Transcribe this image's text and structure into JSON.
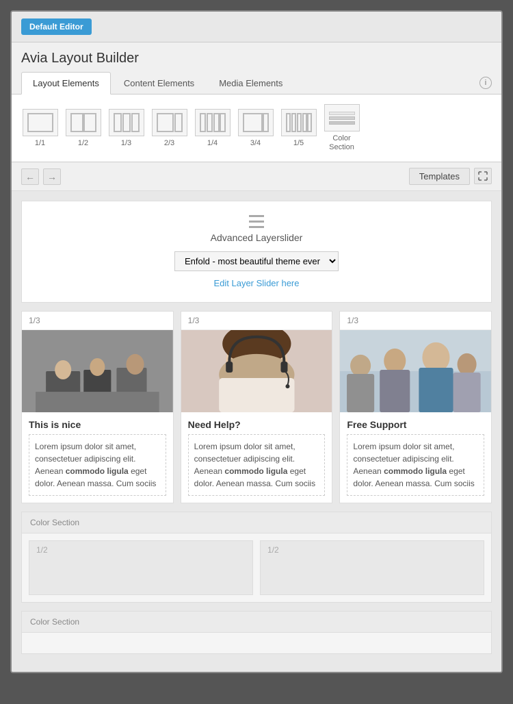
{
  "topBar": {
    "defaultEditorLabel": "Default Editor"
  },
  "pageTitle": "Avia Layout Builder",
  "tabs": [
    {
      "id": "layout",
      "label": "Layout Elements",
      "active": true
    },
    {
      "id": "content",
      "label": "Content Elements",
      "active": false
    },
    {
      "id": "media",
      "label": "Media Elements",
      "active": false
    }
  ],
  "elements": [
    {
      "label": "1/1",
      "type": "single"
    },
    {
      "label": "1/2",
      "type": "half"
    },
    {
      "label": "1/3",
      "type": "third"
    },
    {
      "label": "2/3",
      "type": "two-third"
    },
    {
      "label": "1/4",
      "type": "quarter"
    },
    {
      "label": "3/4",
      "type": "three-quarter"
    },
    {
      "label": "1/5",
      "type": "fifth"
    },
    {
      "label": "Color\nSection",
      "type": "color"
    }
  ],
  "toolbar": {
    "undoLabel": "←",
    "redoLabel": "→",
    "templatesLabel": "Templates",
    "fullscreenLabel": "⛶"
  },
  "layerSlider": {
    "title": "Advanced Layerslider",
    "selectValue": "Enfold - most beautiful theme ever",
    "editLink": "Edit Layer Slider here"
  },
  "columns": [
    {
      "header": "1/3",
      "imageAlt": "business meeting",
      "contentTitle": "This is nice",
      "bodyText": "Lorem ipsum dolor sit amet, consectetuer adipiscing elit. Aenean ",
      "boldText": "commodo ligula",
      "bodyText2": " eget dolor. Aenean massa. Cum sociis"
    },
    {
      "header": "1/3",
      "imageAlt": "customer support",
      "contentTitle": "Need Help?",
      "bodyText": "Lorem ipsum dolor sit amet, consectetuer adipiscing elit. Aenean ",
      "boldText": "commodo ligula",
      "bodyText2": " eget dolor. Aenean massa. Cum sociis"
    },
    {
      "header": "1/3",
      "imageAlt": "free support team",
      "contentTitle": "Free Support",
      "bodyText": "Lorem ipsum dolor sit amet, consectetuer adipiscing elit. Aenean ",
      "boldText": "commodo ligula",
      "bodyText2": " eget dolor. Aenean massa. Cum sociis"
    }
  ],
  "colorSections": [
    {
      "label": "Color Section",
      "cols": [
        {
          "label": "1/2"
        },
        {
          "label": "1/2"
        }
      ]
    },
    {
      "label": "Color Section",
      "cols": []
    }
  ]
}
